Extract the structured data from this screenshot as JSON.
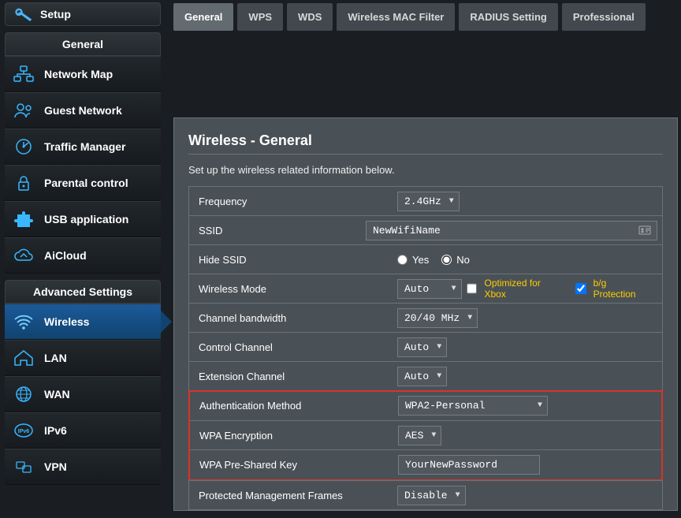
{
  "sidebar": {
    "setup_label": "Setup",
    "section_general": "General",
    "section_advanced": "Advanced Settings",
    "items_general": [
      {
        "label": "Network Map"
      },
      {
        "label": "Guest Network"
      },
      {
        "label": "Traffic Manager"
      },
      {
        "label": "Parental control"
      },
      {
        "label": "USB application"
      },
      {
        "label": "AiCloud"
      }
    ],
    "items_advanced": [
      {
        "label": "Wireless"
      },
      {
        "label": "LAN"
      },
      {
        "label": "WAN"
      },
      {
        "label": "IPv6"
      },
      {
        "label": "VPN"
      }
    ]
  },
  "tabs": [
    "General",
    "WPS",
    "WDS",
    "Wireless MAC Filter",
    "RADIUS Setting",
    "Professional"
  ],
  "panel": {
    "title": "Wireless - General",
    "desc": "Set up the wireless related information below.",
    "fields": {
      "frequency_label": "Frequency",
      "frequency_value": "2.4GHz",
      "ssid_label": "SSID",
      "ssid_value": "NewWifiName",
      "hide_ssid_label": "Hide SSID",
      "hide_yes": "Yes",
      "hide_no": "No",
      "wireless_mode_label": "Wireless Mode",
      "wireless_mode_value": "Auto",
      "opt_xbox": "Optimized for Xbox",
      "bg_protection": "b/g Protection",
      "ch_bw_label": "Channel bandwidth",
      "ch_bw_value": "20/40 MHz",
      "ctrl_ch_label": "Control Channel",
      "ctrl_ch_value": "Auto",
      "ext_ch_label": "Extension Channel",
      "ext_ch_value": "Auto",
      "auth_label": "Authentication Method",
      "auth_value": "WPA2-Personal",
      "wpa_enc_label": "WPA Encryption",
      "wpa_enc_value": "AES",
      "psk_label": "WPA Pre-Shared Key",
      "psk_value": "YourNewPassword",
      "pmf_label": "Protected Management Frames",
      "pmf_value": "Disable"
    }
  }
}
